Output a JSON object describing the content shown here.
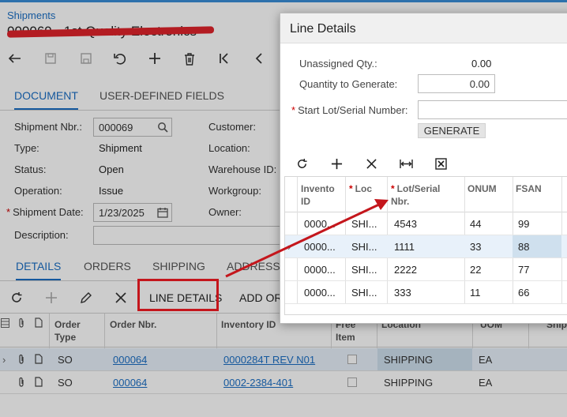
{
  "screen": {
    "breadcrumb": "Shipments",
    "title": "000069 - 1st Quality Electronics",
    "toolbar_icons": [
      "undo-icon",
      "save-draft-icon",
      "save-icon",
      "revert-icon",
      "add-icon",
      "delete-icon",
      "first-record-icon",
      "previous-record-icon"
    ],
    "tabs": [
      "DOCUMENT",
      "USER-DEFINED FIELDS"
    ],
    "form": {
      "shipment_nbr_label": "Shipment Nbr.:",
      "shipment_nbr_value": "000069",
      "type_label": "Type:",
      "type_value": "Shipment",
      "status_label": "Status:",
      "status_value": "Open",
      "operation_label": "Operation:",
      "operation_value": "Issue",
      "shipment_date_label": "Shipment Date:",
      "shipment_date_value": "1/23/2025",
      "description_label": "Description:",
      "customer_label": "Customer:",
      "location_label": "Location:",
      "warehouse_label": "Warehouse ID:",
      "workgroup_label": "Workgroup:",
      "owner_label": "Owner:"
    },
    "detail_tabs": [
      "DETAILS",
      "ORDERS",
      "SHIPPING",
      "ADDRESSES"
    ],
    "grid_toolbar": {
      "line_details_label": "LINE DETAILS",
      "add_order_label": "ADD OR"
    },
    "grid": {
      "columns": [
        "Order Type",
        "Order Nbr.",
        "Inventory ID",
        "Free Item",
        "Location",
        "UOM",
        "Ship"
      ],
      "rows": [
        {
          "order_type": "SO",
          "order_nbr": "000064",
          "inventory_id": "0000284T REV N01",
          "location": "SHIPPING",
          "uom": "EA"
        },
        {
          "order_type": "SO",
          "order_nbr": "000064",
          "inventory_id": "0002-2384-401",
          "location": "SHIPPING",
          "uom": "EA"
        }
      ]
    }
  },
  "dialog": {
    "title": "Line Details",
    "unassigned_qty_label": "Unassigned Qty.:",
    "unassigned_qty_value": "0.00",
    "qty_to_generate_label": "Quantity to Generate:",
    "qty_to_generate_value": "0.00",
    "start_lot_label": "Start Lot/Serial Number:",
    "start_lot_value": "",
    "generate_label": "GENERATE",
    "columns": {
      "inventory_id": "Invento ID",
      "loc": "Loc",
      "lot_serial": "Lot/Serial Nbr.",
      "onum": "ONUM",
      "fsan": "FSAN"
    },
    "rows": [
      {
        "inventory": "0000...",
        "loc": "SHI...",
        "lot": "4543",
        "onum": "44",
        "fsan": "99"
      },
      {
        "inventory": "0000...",
        "loc": "SHI...",
        "lot": "1111",
        "onum": "33",
        "fsan": "88"
      },
      {
        "inventory": "0000...",
        "loc": "SHI...",
        "lot": "2222",
        "onum": "22",
        "fsan": "77"
      },
      {
        "inventory": "0000...",
        "loc": "SHI...",
        "lot": "333",
        "onum": "11",
        "fsan": "66"
      }
    ]
  },
  "colors": {
    "accent": "#1b6fc5",
    "annotation_red": "#c4161c",
    "selected_row": "#e8f1fa"
  }
}
